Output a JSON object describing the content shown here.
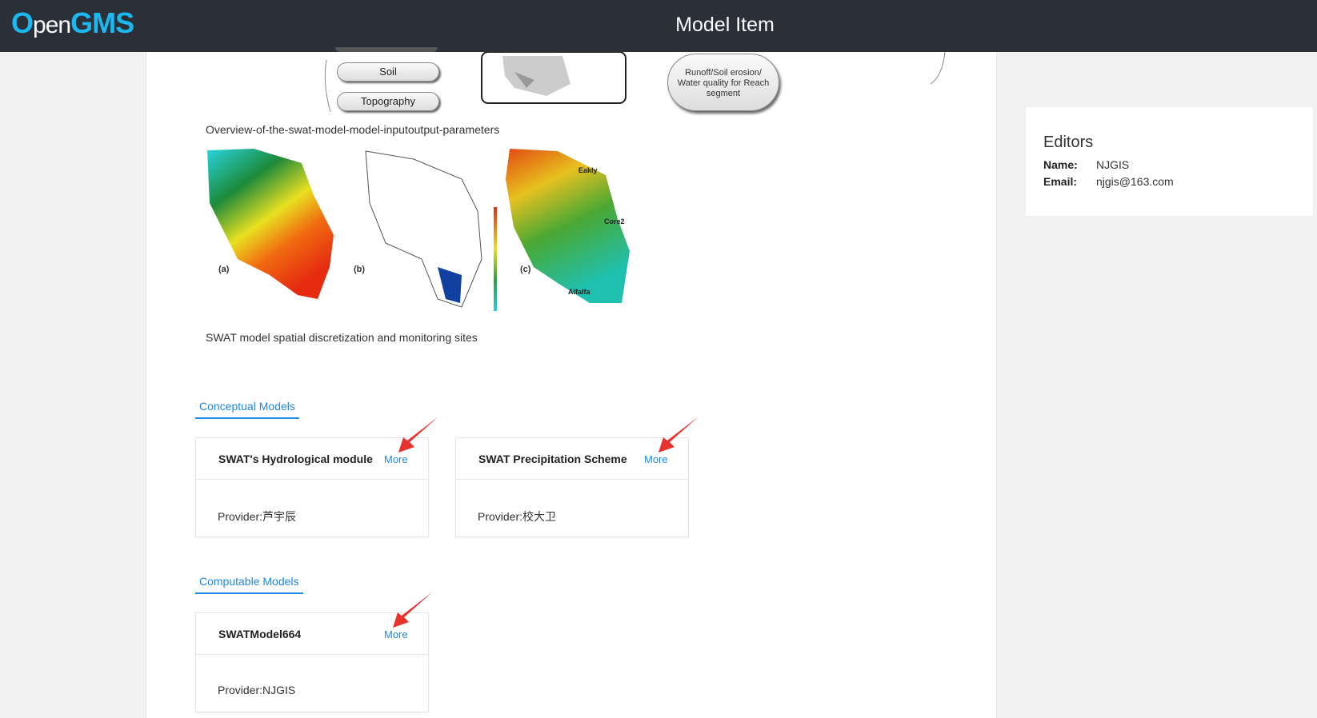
{
  "header": {
    "logo": "OpenGMS",
    "title": "Model Item"
  },
  "figures": [
    {
      "caption": "Overview-of-the-swat-model-model-inputoutput-parameters",
      "labels": [
        "Soil",
        "Topography",
        "Runoff/Soil erosion/ Water quality for Reach segment"
      ]
    },
    {
      "caption": "SWAT model spatial discretization and monitoring sites",
      "labels": [
        "(a)",
        "(b)",
        "(c)",
        "Eakly",
        "Core2",
        "Alfalfa"
      ]
    }
  ],
  "conceptual": {
    "tab": "Conceptual Models",
    "cards": [
      {
        "title": "SWAT's Hydrological module",
        "more": "More",
        "provider": "Provider:芦宇辰"
      },
      {
        "title": "SWAT Precipitation Scheme",
        "more": "More",
        "provider": "Provider:校大卫"
      }
    ]
  },
  "computable": {
    "tab": "Computable Models",
    "cards": [
      {
        "title": "SWATModel664",
        "more": "More",
        "provider": "Provider:NJGIS"
      }
    ]
  },
  "editors": {
    "title": "Editors",
    "name_label": "Name:",
    "name": "NJGIS",
    "email_label": "Email:",
    "email": "njgis@163.com"
  },
  "colors": {
    "header": "#2b2f37",
    "accent": "#1e88e5",
    "logo": "#1cb8f0",
    "arrow": "#e8322e"
  }
}
